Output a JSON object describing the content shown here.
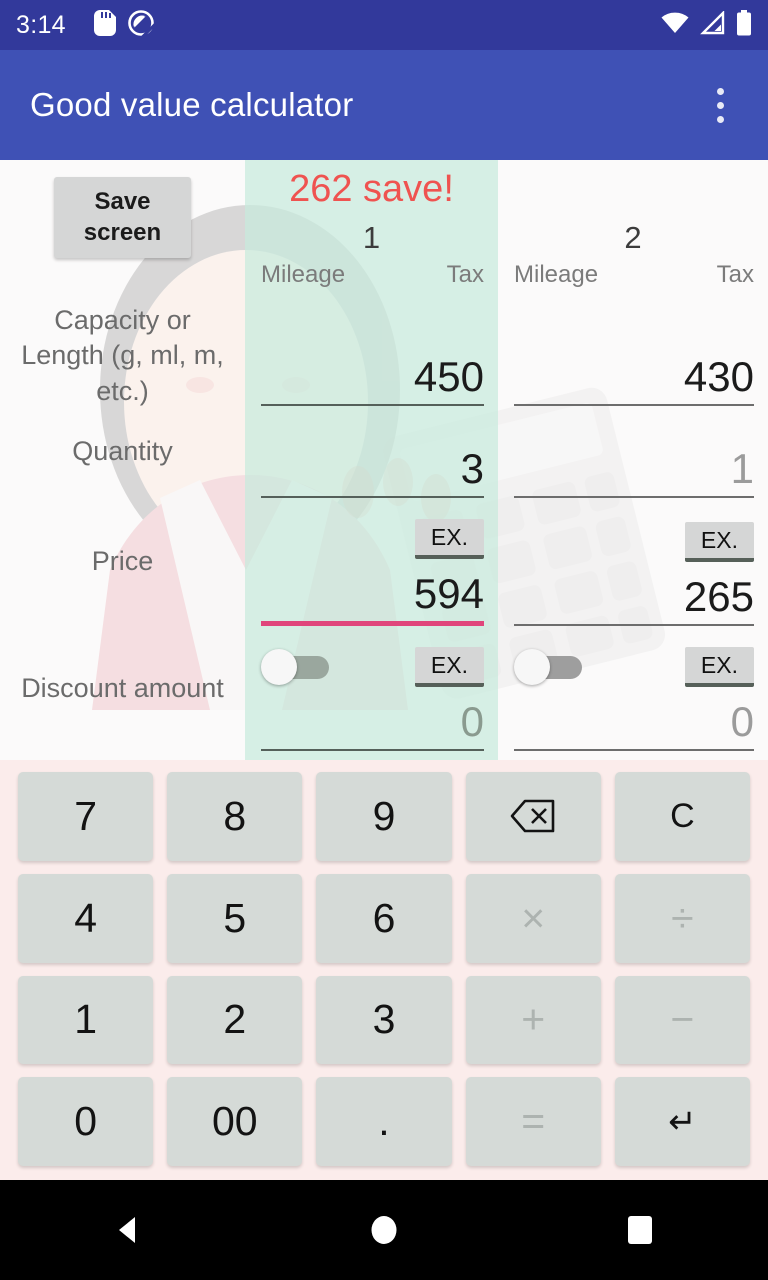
{
  "status_bar": {
    "time": "3:14",
    "icons_left": [
      "sd-card-icon",
      "do-not-disturb-icon"
    ],
    "icons_right": [
      "wifi-icon",
      "cellular-no-sim-icon",
      "battery-icon"
    ]
  },
  "app_bar": {
    "title": "Good value calculator",
    "overflow_icon": "more-vertical-icon",
    "background_color": "#3f51b5"
  },
  "main": {
    "save_screen_label": "Save screen",
    "savings_banner": "262 save!",
    "savings_banner_color": "#ef5350",
    "highlight_color": "#c8eadc",
    "focus_underline_color": "#e0457b",
    "row_labels": {
      "capacity": "Capacity or Length (g, ml, m, etc.)",
      "quantity": "Quantity",
      "price": "Price",
      "discount": "Discount amount"
    },
    "sub_headers": {
      "mileage": "Mileage",
      "tax": "Tax"
    },
    "ex_label": "EX.",
    "columns": [
      {
        "number": "1",
        "selected": true,
        "capacity": "450",
        "capacity_placeholder": false,
        "quantity": "3",
        "quantity_placeholder": false,
        "price": "594",
        "price_focused": true,
        "discount": "0",
        "discount_placeholder": true,
        "discount_toggle_on": false
      },
      {
        "number": "2",
        "selected": false,
        "capacity": "430",
        "capacity_placeholder": false,
        "quantity": "1",
        "quantity_placeholder": true,
        "price": "265",
        "price_focused": false,
        "discount": "0",
        "discount_placeholder": true,
        "discount_toggle_on": false
      }
    ]
  },
  "keypad": {
    "background_color": "#fbeceb",
    "rows": [
      [
        {
          "label": "7",
          "kind": "digit"
        },
        {
          "label": "8",
          "kind": "digit"
        },
        {
          "label": "9",
          "kind": "digit"
        },
        {
          "label": "backspace-icon",
          "kind": "backspace"
        },
        {
          "label": "C",
          "kind": "clear"
        }
      ],
      [
        {
          "label": "4",
          "kind": "digit"
        },
        {
          "label": "5",
          "kind": "digit"
        },
        {
          "label": "6",
          "kind": "digit"
        },
        {
          "label": "×",
          "kind": "op"
        },
        {
          "label": "÷",
          "kind": "op"
        }
      ],
      [
        {
          "label": "1",
          "kind": "digit"
        },
        {
          "label": "2",
          "kind": "digit"
        },
        {
          "label": "3",
          "kind": "digit"
        },
        {
          "label": "+",
          "kind": "op"
        },
        {
          "label": "−",
          "kind": "op"
        }
      ],
      [
        {
          "label": "0",
          "kind": "digit"
        },
        {
          "label": "00",
          "kind": "digit"
        },
        {
          "label": ".",
          "kind": "digit"
        },
        {
          "label": "=",
          "kind": "op"
        },
        {
          "label": "↵",
          "kind": "enter"
        }
      ]
    ]
  },
  "nav_bar": {
    "back": "back-icon",
    "home": "home-icon",
    "recents": "recents-icon"
  }
}
